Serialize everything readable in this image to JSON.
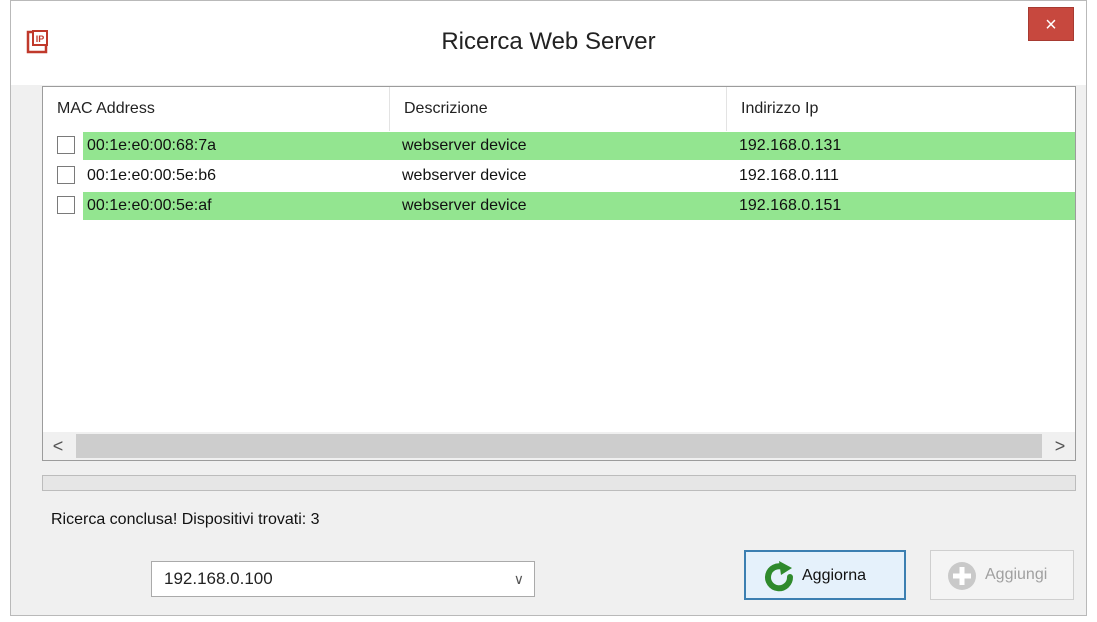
{
  "window": {
    "title": "Ricerca Web Server",
    "close_label": "×"
  },
  "table": {
    "columns": [
      "MAC Address",
      "Descrizione",
      "Indirizzo Ip"
    ],
    "rows": [
      {
        "mac": "00:1e:e0:00:68:7a",
        "descrizione": "webserver device",
        "ip": "192.168.0.131",
        "highlighted": true,
        "checked": false
      },
      {
        "mac": "00:1e:e0:00:5e:b6",
        "descrizione": "webserver device",
        "ip": "192.168.0.111",
        "highlighted": false,
        "checked": false
      },
      {
        "mac": "00:1e:e0:00:5e:af",
        "descrizione": "webserver device",
        "ip": "192.168.0.151",
        "highlighted": true,
        "checked": false
      }
    ],
    "scroll_left": "<",
    "scroll_right": ">"
  },
  "progress": {
    "value": 0
  },
  "status_text": "Ricerca conclusa! Dispositivi trovati: 3",
  "ip_select": {
    "selected": "192.168.0.100",
    "chevron": "∨"
  },
  "buttons": {
    "aggiorna": {
      "label": "Aggiorna",
      "icon": "refresh-icon",
      "enabled": true
    },
    "aggiungi": {
      "label": "Aggiungi",
      "icon": "plus-icon",
      "enabled": false
    }
  },
  "colors": {
    "highlight": "#93e590",
    "close": "#c7483e",
    "accent_border": "#3c7fb1"
  }
}
